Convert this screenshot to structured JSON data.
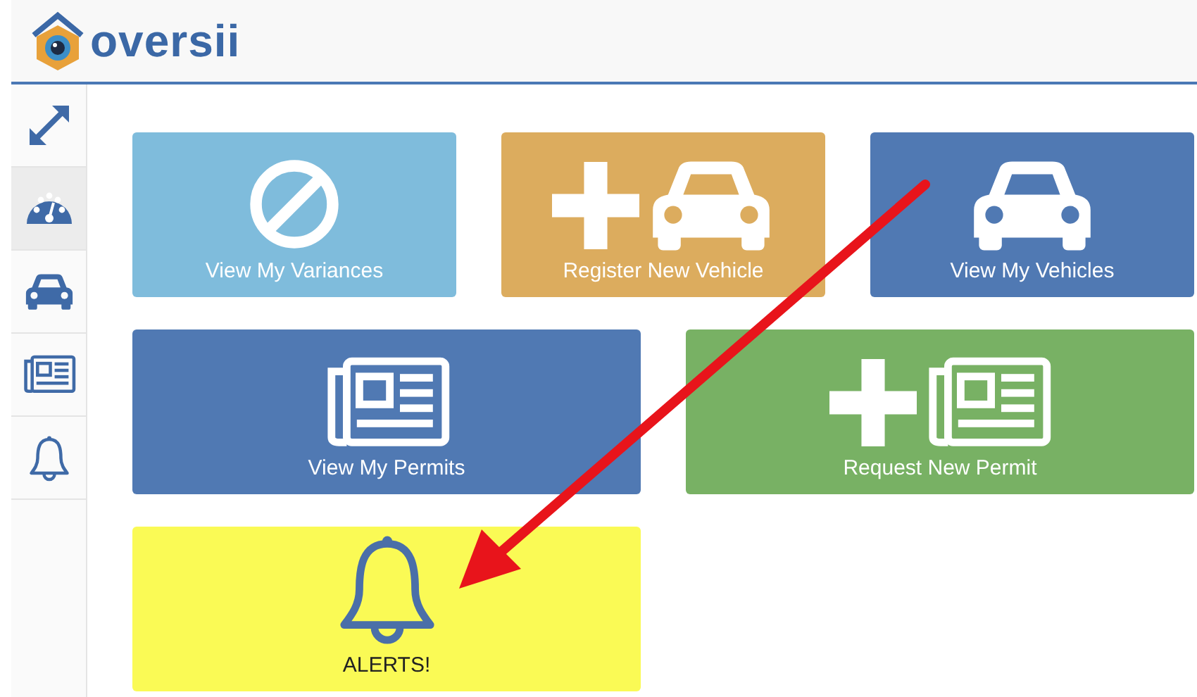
{
  "header": {
    "logo_text": "oversii"
  },
  "sidebar": {
    "items": [
      {
        "kind": "expand",
        "selected": false
      },
      {
        "kind": "gauge",
        "selected": true
      },
      {
        "kind": "car",
        "selected": false
      },
      {
        "kind": "newspaper",
        "selected": false
      },
      {
        "kind": "bell",
        "selected": false
      }
    ]
  },
  "tiles": [
    [
      {
        "label": "View My Variances",
        "kind": "ban",
        "color": "#7fbcdc"
      },
      {
        "label": "Register New Vehicle",
        "kind": "add-car",
        "color": "#dcac5e"
      },
      {
        "label": "View My Vehicles",
        "kind": "car",
        "color": "#5079b3"
      }
    ],
    [
      {
        "label": "View My Permits",
        "kind": "newspaper",
        "color": "#5079b3"
      },
      {
        "label": "Request New Permit",
        "kind": "add-newspaper",
        "color": "#78b164"
      }
    ],
    [
      {
        "label": "ALERTS!",
        "kind": "bell",
        "color": "#fafa55"
      }
    ]
  ]
}
